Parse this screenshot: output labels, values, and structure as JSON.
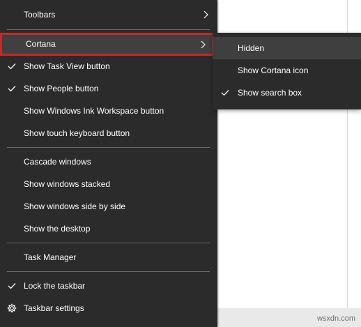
{
  "window": {
    "watermark": "wsxdn.com"
  },
  "menu": {
    "items": [
      {
        "label": "Toolbars",
        "check": false,
        "submenu": true
      },
      {
        "label": "Cortana",
        "check": false,
        "submenu": true,
        "highlighted": true
      },
      {
        "label": "Show Task View button",
        "check": true,
        "submenu": false
      },
      {
        "label": "Show People button",
        "check": true,
        "submenu": false
      },
      {
        "label": "Show Windows Ink Workspace button",
        "check": false,
        "submenu": false
      },
      {
        "label": "Show touch keyboard button",
        "check": false,
        "submenu": false
      },
      {
        "label": "Cascade windows",
        "check": false,
        "submenu": false
      },
      {
        "label": "Show windows stacked",
        "check": false,
        "submenu": false
      },
      {
        "label": "Show windows side by side",
        "check": false,
        "submenu": false
      },
      {
        "label": "Show the desktop",
        "check": false,
        "submenu": false
      },
      {
        "label": "Task Manager",
        "check": false,
        "submenu": false
      },
      {
        "label": "Lock the taskbar",
        "check": true,
        "submenu": false
      },
      {
        "label": "Taskbar settings",
        "check": false,
        "submenu": false,
        "icon": "gear-icon"
      }
    ]
  },
  "cortana_submenu": {
    "items": [
      {
        "label": "Hidden",
        "check": false,
        "active": true
      },
      {
        "label": "Show Cortana icon",
        "check": false,
        "active": false
      },
      {
        "label": "Show search box",
        "check": true,
        "active": false
      }
    ]
  },
  "colors": {
    "menu_bg": "#2b2b2b",
    "highlight_border": "#c62828",
    "text": "#ffffff",
    "divider": "#6a6a6a",
    "submenu_active": "#3f3f3f"
  }
}
